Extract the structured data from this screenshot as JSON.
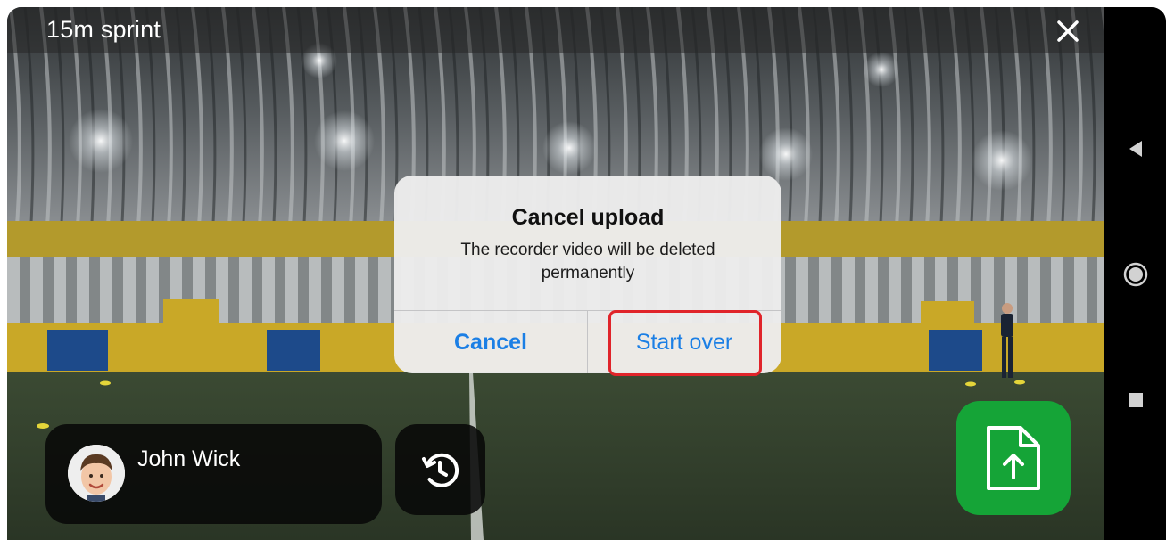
{
  "header": {
    "title": "15m sprint",
    "close_icon": "close-icon"
  },
  "dialog": {
    "title": "Cancel upload",
    "message": "The recorder video will be deleted permanently",
    "cancel_label": "Cancel",
    "confirm_label": "Start over"
  },
  "athlete": {
    "name": "John Wick",
    "avatar_icon": "avatar"
  },
  "controls": {
    "retake_icon": "retake-icon",
    "upload_icon": "upload-file-icon"
  },
  "system_nav": {
    "back_icon": "back-icon",
    "home_icon": "home-icon",
    "recents_icon": "recents-icon"
  },
  "colors": {
    "accent_blue": "#1b7fe5",
    "upload_green": "#15a437",
    "highlight_red": "#e0242a"
  }
}
